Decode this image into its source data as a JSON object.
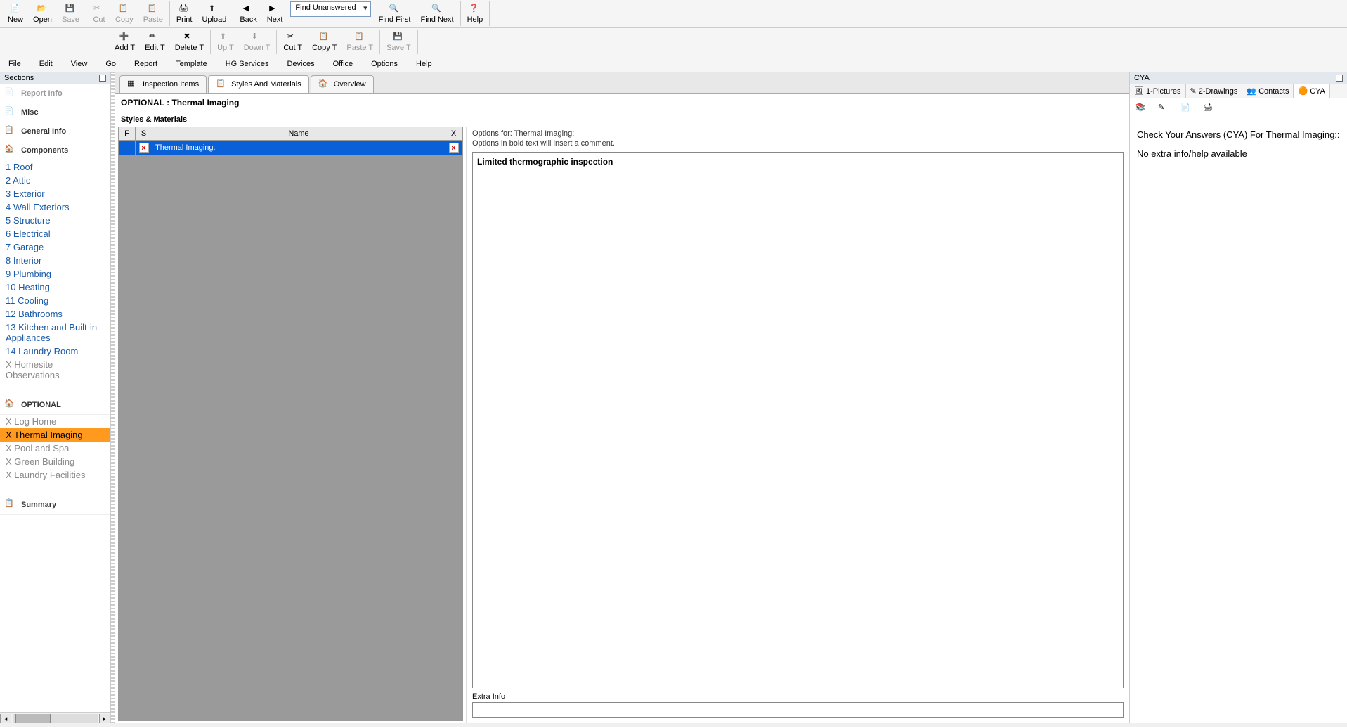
{
  "toolbar1": [
    {
      "id": "new",
      "label": "New",
      "icon": "i-new"
    },
    {
      "id": "open",
      "label": "Open",
      "icon": "i-open"
    },
    {
      "id": "save",
      "label": "Save",
      "icon": "i-save",
      "disabled": true
    },
    {
      "sep": true
    },
    {
      "id": "cut",
      "label": "Cut",
      "icon": "i-cut",
      "disabled": true
    },
    {
      "id": "copy",
      "label": "Copy",
      "icon": "i-copy",
      "disabled": true
    },
    {
      "id": "paste",
      "label": "Paste",
      "icon": "i-paste",
      "disabled": true
    },
    {
      "sep": true
    },
    {
      "id": "print",
      "label": "Print",
      "icon": "i-print"
    },
    {
      "id": "upload",
      "label": "Upload",
      "icon": "i-upload"
    },
    {
      "sep": true
    },
    {
      "id": "back",
      "label": "Back",
      "icon": "i-back"
    },
    {
      "id": "next",
      "label": "Next",
      "icon": "i-next"
    },
    {
      "combo": true,
      "id": "find-combo",
      "value": "Find Unanswered"
    },
    {
      "id": "findfirst",
      "label": "Find First",
      "icon": "i-find1"
    },
    {
      "id": "findnext",
      "label": "Find Next",
      "icon": "i-find2"
    },
    {
      "sep": true
    },
    {
      "id": "help",
      "label": "Help",
      "icon": "i-help"
    }
  ],
  "toolbar2": [
    {
      "id": "addt",
      "label": "Add T",
      "icon": "i-addt"
    },
    {
      "id": "editt",
      "label": "Edit T",
      "icon": "i-editt"
    },
    {
      "id": "deletet",
      "label": "Delete T",
      "icon": "i-deletet"
    },
    {
      "sep": true
    },
    {
      "id": "upt",
      "label": "Up T",
      "icon": "i-upt",
      "disabled": true
    },
    {
      "id": "downt",
      "label": "Down T",
      "icon": "i-downt",
      "disabled": true
    },
    {
      "sep": true
    },
    {
      "id": "cutt",
      "label": "Cut T",
      "icon": "i-cutt"
    },
    {
      "id": "copyt",
      "label": "Copy T",
      "icon": "i-copyt"
    },
    {
      "id": "pastet",
      "label": "Paste T",
      "icon": "i-pastet",
      "disabled": true
    },
    {
      "sep": true
    },
    {
      "id": "savet",
      "label": "Save T",
      "icon": "i-savet",
      "disabled": true
    }
  ],
  "menubar": [
    "File",
    "Edit",
    "View",
    "Go",
    "Report",
    "Template",
    "HG Services",
    "Devices",
    "Office",
    "Options",
    "Help"
  ],
  "leftPanel": {
    "title": "Sections",
    "headers": {
      "reportInfo": "Report Info",
      "misc": "Misc",
      "general": "General Info",
      "components": "Components",
      "optional": "OPTIONAL",
      "summary": "Summary"
    },
    "componentsList": [
      "1 Roof",
      "2 Attic",
      "3 Exterior",
      "4 Wall Exteriors",
      "5 Structure",
      "6 Electrical",
      "7 Garage",
      "8 Interior",
      "9 Plumbing",
      "10 Heating",
      "11 Cooling",
      "12 Bathrooms",
      "13 Kitchen and Built-in Appliances",
      "14 Laundry Room"
    ],
    "componentsExtra": "X Homesite Observations",
    "optionalList": [
      {
        "label": "X Log Home",
        "selected": false
      },
      {
        "label": "X Thermal Imaging",
        "selected": true
      },
      {
        "label": "X Pool and Spa",
        "selected": false
      },
      {
        "label": "X Green Building",
        "selected": false
      },
      {
        "label": "X Laundry Facilities",
        "selected": false
      }
    ]
  },
  "centerTabs": [
    {
      "id": "inspection-items",
      "label": "Inspection Items",
      "icon": "i-list"
    },
    {
      "id": "styles-materials",
      "label": "Styles And Materials",
      "icon": "i-styles",
      "active": true
    },
    {
      "id": "overview",
      "label": "Overview",
      "icon": "i-overview"
    }
  ],
  "contentTitle": "OPTIONAL : Thermal Imaging",
  "stylesLabel": "Styles & Materials",
  "gridHeaders": {
    "f": "F",
    "s": "S",
    "name": "Name",
    "x": "X"
  },
  "gridRows": [
    {
      "name": "Thermal Imaging:"
    }
  ],
  "options": {
    "header": "Options for: Thermal Imaging:",
    "sub": "Options in bold text will insert a comment.",
    "items": [
      "Limited thermographic inspection"
    ],
    "extraLabel": "Extra Info",
    "extraValue": ""
  },
  "rightPanel": {
    "title": "CYA",
    "tabs": [
      {
        "id": "pictures",
        "label": "1-Pictures",
        "icon": "i-pic"
      },
      {
        "id": "drawings",
        "label": "2-Drawings",
        "icon": "i-draw"
      },
      {
        "id": "contacts",
        "label": "Contacts",
        "icon": "i-contacts"
      },
      {
        "id": "cya",
        "label": "CYA",
        "icon": "i-cya",
        "active": true
      }
    ],
    "heading": "Check Your Answers (CYA) For Thermal Imaging::",
    "body": "No extra info/help available"
  }
}
